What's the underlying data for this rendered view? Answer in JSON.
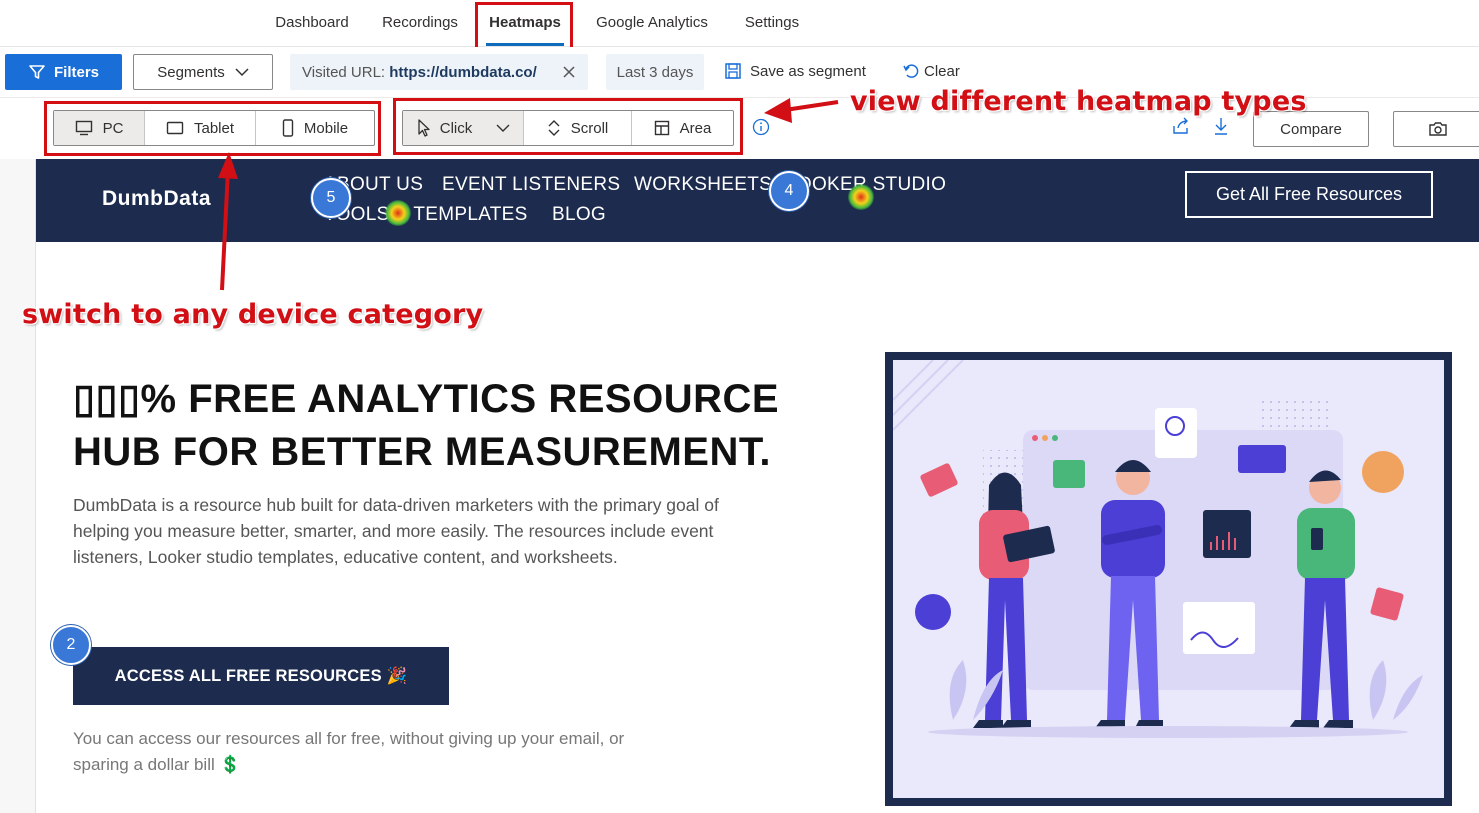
{
  "nav": {
    "tabs": [
      "Dashboard",
      "Recordings",
      "Heatmaps",
      "Google Analytics",
      "Settings"
    ],
    "active": "Heatmaps"
  },
  "filterbar": {
    "filters_label": "Filters",
    "segments_label": "Segments",
    "url_prefix": "Visited URL:",
    "url_value": "https://dumbdata.co/",
    "date_range": "Last 3 days",
    "save_segment": "Save as segment",
    "clear": "Clear"
  },
  "toolbar": {
    "devices": [
      "PC",
      "Tablet",
      "Mobile"
    ],
    "selected_device": "PC",
    "heatmap_types": [
      "Click",
      "Scroll",
      "Area"
    ],
    "selected_type": "Click",
    "compare": "Compare"
  },
  "site": {
    "logo": "DumbData",
    "links_row1": [
      "ABOUT US",
      "EVENT LISTENERS",
      "WORKSHEETS",
      "LOOKER STUDIO"
    ],
    "links_row2": [
      "TOOLS & TEMPLATES",
      "BLOG"
    ],
    "cta_top": "Get All Free Resources",
    "hero_title_line1": "▯▯▯% FREE ANALYTICS RESOURCE",
    "hero_title_line2": "HUB FOR BETTER MEASUREMENT.",
    "hero_text": "DumbData is a resource hub built for data-driven marketers with the primary goal of helping you measure better, smarter, and more easily. The resources include event listeners, Looker studio templates, educative content, and worksheets.",
    "hero_button": "ACCESS ALL FREE RESOURCES 🎉",
    "hero_note": "You can access our resources all for free, without giving up your email, or sparing a dollar bill 💲"
  },
  "click_badges": [
    "5",
    "4",
    "2"
  ],
  "annotations": {
    "device_note": "switch to any device category",
    "types_note": "view different heatmap types"
  },
  "colors": {
    "accent": "#1a6ed8",
    "site_navy": "#1d2b4f",
    "annotation_red": "#d10f15"
  }
}
